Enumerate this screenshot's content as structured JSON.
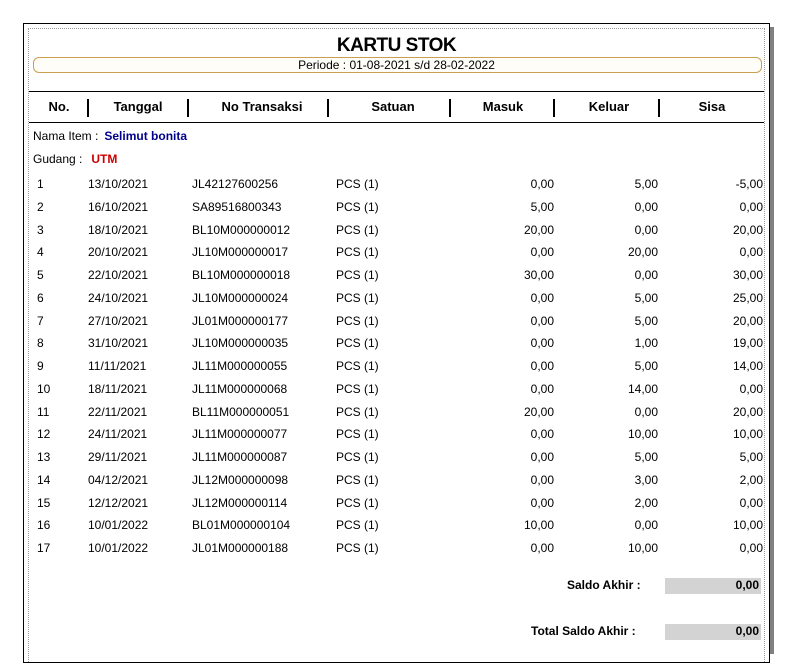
{
  "report": {
    "title": "KARTU STOK",
    "period": "Periode : 01-08-2021 s/d 28-02-2022"
  },
  "columns": {
    "no": "No.",
    "tanggal": "Tanggal",
    "no_transaksi": "No Transaksi",
    "satuan": "Satuan",
    "masuk": "Masuk",
    "keluar": "Keluar",
    "sisa": "Sisa"
  },
  "item": {
    "label": "Nama Item :",
    "value": "Selimut bonita"
  },
  "gudang": {
    "label": "Gudang :",
    "value": "UTM"
  },
  "rows": [
    {
      "no": "1",
      "tanggal": "13/10/2021",
      "trx": "JL42127600256",
      "satuan": "PCS (1)",
      "masuk": "0,00",
      "keluar": "5,00",
      "sisa": "-5,00"
    },
    {
      "no": "2",
      "tanggal": "16/10/2021",
      "trx": "SA89516800343",
      "satuan": "PCS (1)",
      "masuk": "5,00",
      "keluar": "0,00",
      "sisa": "0,00"
    },
    {
      "no": "3",
      "tanggal": "18/10/2021",
      "trx": "BL10M000000012",
      "satuan": "PCS (1)",
      "masuk": "20,00",
      "keluar": "0,00",
      "sisa": "20,00"
    },
    {
      "no": "4",
      "tanggal": "20/10/2021",
      "trx": "JL10M000000017",
      "satuan": "PCS (1)",
      "masuk": "0,00",
      "keluar": "20,00",
      "sisa": "0,00"
    },
    {
      "no": "5",
      "tanggal": "22/10/2021",
      "trx": "BL10M000000018",
      "satuan": "PCS (1)",
      "masuk": "30,00",
      "keluar": "0,00",
      "sisa": "30,00"
    },
    {
      "no": "6",
      "tanggal": "24/10/2021",
      "trx": "JL10M000000024",
      "satuan": "PCS (1)",
      "masuk": "0,00",
      "keluar": "5,00",
      "sisa": "25,00"
    },
    {
      "no": "7",
      "tanggal": "27/10/2021",
      "trx": "JL01M000000177",
      "satuan": "PCS (1)",
      "masuk": "0,00",
      "keluar": "5,00",
      "sisa": "20,00"
    },
    {
      "no": "8",
      "tanggal": "31/10/2021",
      "trx": "JL10M000000035",
      "satuan": "PCS (1)",
      "masuk": "0,00",
      "keluar": "1,00",
      "sisa": "19,00"
    },
    {
      "no": "9",
      "tanggal": "11/11/2021",
      "trx": "JL11M000000055",
      "satuan": "PCS (1)",
      "masuk": "0,00",
      "keluar": "5,00",
      "sisa": "14,00"
    },
    {
      "no": "10",
      "tanggal": "18/11/2021",
      "trx": "JL11M000000068",
      "satuan": "PCS (1)",
      "masuk": "0,00",
      "keluar": "14,00",
      "sisa": "0,00"
    },
    {
      "no": "11",
      "tanggal": "22/11/2021",
      "trx": "BL11M000000051",
      "satuan": "PCS (1)",
      "masuk": "20,00",
      "keluar": "0,00",
      "sisa": "20,00"
    },
    {
      "no": "12",
      "tanggal": "24/11/2021",
      "trx": "JL11M000000077",
      "satuan": "PCS (1)",
      "masuk": "0,00",
      "keluar": "10,00",
      "sisa": "10,00"
    },
    {
      "no": "13",
      "tanggal": "29/11/2021",
      "trx": "JL11M000000087",
      "satuan": "PCS (1)",
      "masuk": "0,00",
      "keluar": "5,00",
      "sisa": "5,00"
    },
    {
      "no": "14",
      "tanggal": "04/12/2021",
      "trx": "JL12M000000098",
      "satuan": "PCS (1)",
      "masuk": "0,00",
      "keluar": "3,00",
      "sisa": "2,00"
    },
    {
      "no": "15",
      "tanggal": "12/12/2021",
      "trx": "JL12M000000114",
      "satuan": "PCS (1)",
      "masuk": "0,00",
      "keluar": "2,00",
      "sisa": "0,00"
    },
    {
      "no": "16",
      "tanggal": "10/01/2022",
      "trx": "BL01M000000104",
      "satuan": "PCS (1)",
      "masuk": "10,00",
      "keluar": "0,00",
      "sisa": "10,00"
    },
    {
      "no": "17",
      "tanggal": "10/01/2022",
      "trx": "JL01M000000188",
      "satuan": "PCS (1)",
      "masuk": "0,00",
      "keluar": "10,00",
      "sisa": "0,00"
    }
  ],
  "saldo": {
    "label": "Saldo Akhir :",
    "value": "0,00"
  },
  "total_saldo": {
    "label": "Total Saldo Akhir :",
    "value": "0,00"
  }
}
